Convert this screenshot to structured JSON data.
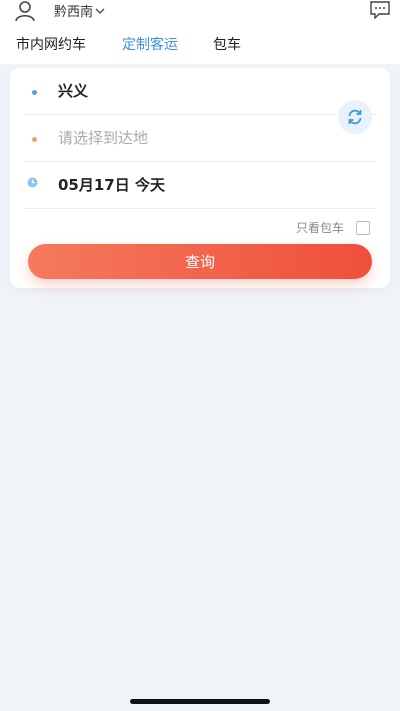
{
  "header": {
    "region": "黔西南",
    "user_icon": "user-icon",
    "message_icon": "message-icon"
  },
  "tabs": [
    {
      "label": "市内网约车",
      "active": false
    },
    {
      "label": "定制客运",
      "active": true
    },
    {
      "label": "包车",
      "active": false
    }
  ],
  "search": {
    "from": "兴义",
    "to_placeholder": "请选择到达地",
    "date": "05月17日 今天",
    "charter_only_label": "只看包车",
    "charter_only_checked": false,
    "query_label": "查询"
  },
  "colors": {
    "accent_blue": "#3f94d8",
    "query_start": "#f57a5e",
    "query_end": "#ef4f3a",
    "background": "#f0f3f8"
  }
}
